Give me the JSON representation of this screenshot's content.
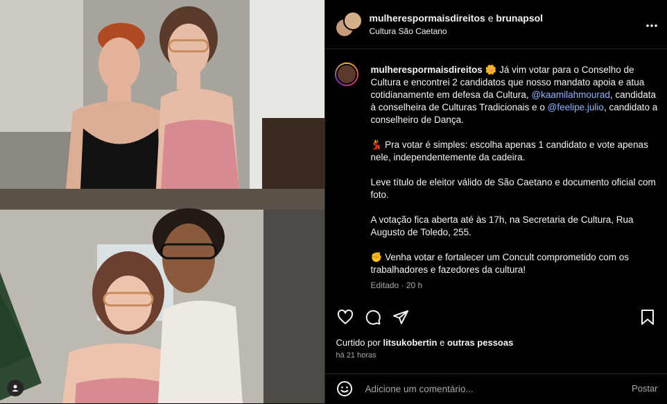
{
  "header": {
    "user1": "mulherespormaisdireitos",
    "conj": "e",
    "user2": "brunapsol",
    "location": "Cultura São Caetano",
    "more_icon": "more-horizontal-icon"
  },
  "caption": {
    "user": "mulherespormaisdireitos",
    "p1_start": "🌼 Já vim votar para o Conselho de Cultura e encontrei 2 candidatos que nosso mandato apoia e atua cotidianamente em defesa da Cultura, ",
    "mention1": "@kaamilahmourad",
    "p1_mid": ", candidata à conselheira de Culturas Tradicionais e o ",
    "mention2": "@feelipe.julio",
    "p1_end": ", candidato a conselheiro de Dança.",
    "p2": "💃 Pra votar é simples: escolha apenas 1 candidato e vote apenas nele, independentemente da cadeira.",
    "p3": "Leve título de eleitor válido de São Caetano e documento oficial com foto.",
    "p4": "A votação fica aberta até às 17h, na Secretaria de Cultura, Rua Augusto de Toledo, 255.",
    "p5": "✊ Venha votar e fortalecer um Concult comprometido com os trabalhadores e fazedores da cultura!",
    "meta": "Editado · 20 h"
  },
  "likes": {
    "prefix": "Curtido por",
    "user": "litsukobertin",
    "conj": "e",
    "others": "outras pessoas"
  },
  "time_ago": "há 21 horas",
  "comment": {
    "placeholder": "Adicione um comentário...",
    "post": "Postar"
  },
  "colors": {
    "background": "#000000",
    "text": "#f5f5f5",
    "muted": "#a8a8a8",
    "mention": "#8fb5ff"
  }
}
